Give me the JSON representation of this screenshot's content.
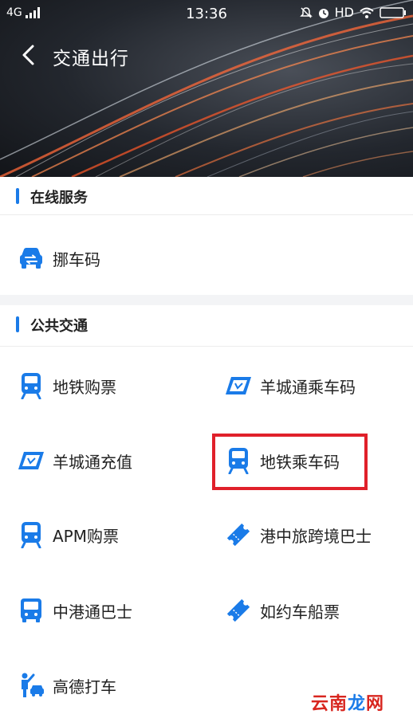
{
  "statusbar": {
    "network": "4G",
    "time": "13:36",
    "hd": "HD"
  },
  "header": {
    "title": "交通出行"
  },
  "online_service": {
    "title": "在线服务",
    "items": [
      {
        "label": "挪车码",
        "icon": "car-swap-icon"
      }
    ]
  },
  "public_transport": {
    "title": "公共交通",
    "items": [
      {
        "label": "地铁购票",
        "icon": "metro-train-icon"
      },
      {
        "label": "羊城通乘车码",
        "icon": "yct-card-icon"
      },
      {
        "label": "羊城通充值",
        "icon": "yct-card-icon"
      },
      {
        "label": "地铁乘车码",
        "icon": "metro-train-icon"
      },
      {
        "label": "APM购票",
        "icon": "metro-train-icon"
      },
      {
        "label": "港中旅跨境巴士",
        "icon": "ticket-icon"
      },
      {
        "label": "中港通巴士",
        "icon": "bus-icon"
      },
      {
        "label": "如约车船票",
        "icon": "ticket-icon"
      },
      {
        "label": "高德打车",
        "icon": "taxi-person-icon"
      }
    ]
  },
  "watermark": {
    "part1": "云南",
    "part2": "龙",
    "part3": "网"
  },
  "colors": {
    "accent": "#1a7be8",
    "highlight": "#e0202a"
  }
}
